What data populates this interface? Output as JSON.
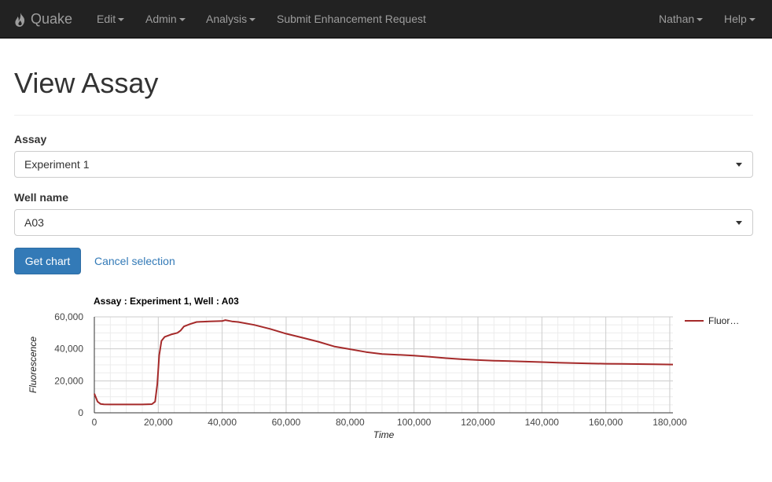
{
  "navbar": {
    "brand": "Quake",
    "menu": [
      {
        "label": "Edit",
        "dropdown": true
      },
      {
        "label": "Admin",
        "dropdown": true
      },
      {
        "label": "Analysis",
        "dropdown": true
      },
      {
        "label": "Submit Enhancement Request",
        "dropdown": false
      }
    ],
    "right_menu": [
      {
        "label": "Nathan",
        "dropdown": true
      },
      {
        "label": "Help",
        "dropdown": true
      }
    ]
  },
  "page": {
    "title": "View Assay"
  },
  "form": {
    "assay_label": "Assay",
    "assay_value": "Experiment 1",
    "well_label": "Well name",
    "well_value": "A03",
    "submit_label": "Get chart",
    "cancel_label": "Cancel selection"
  },
  "colors": {
    "navbar_bg": "#222222",
    "primary": "#337ab7",
    "series": "#a52a2a"
  },
  "chart_data": {
    "type": "line",
    "title": "Assay : Experiment 1, Well : A03",
    "xlabel": "Time",
    "ylabel": "Fluorescence",
    "xlim": [
      0,
      181000
    ],
    "ylim": [
      0,
      60000
    ],
    "x_ticks": [
      "0",
      "20,000",
      "40,000",
      "60,000",
      "80,000",
      "100,000",
      "120,000",
      "140,000",
      "160,000",
      "180,000"
    ],
    "y_ticks": [
      "0",
      "20,000",
      "40,000",
      "60,000"
    ],
    "grid": true,
    "legend": "right",
    "series": [
      {
        "name": "Fluor…",
        "x": [
          0,
          1000,
          2000,
          3000,
          5000,
          10000,
          15000,
          18000,
          19000,
          19700,
          20300,
          21000,
          22000,
          24000,
          26000,
          27000,
          28000,
          30000,
          32000,
          34000,
          36000,
          38000,
          40000,
          41000,
          43000,
          45000,
          50000,
          55000,
          60000,
          65000,
          70000,
          75000,
          80000,
          85000,
          90000,
          95000,
          100000,
          105000,
          110000,
          115000,
          120000,
          125000,
          130000,
          135000,
          140000,
          145000,
          150000,
          155000,
          160000,
          165000,
          170000,
          175000,
          181000
        ],
        "y": [
          12000,
          7000,
          5500,
          5300,
          5200,
          5200,
          5200,
          5400,
          7000,
          18000,
          36000,
          45000,
          47500,
          49000,
          50000,
          51500,
          54000,
          55500,
          56800,
          57000,
          57200,
          57300,
          57400,
          58000,
          57200,
          56800,
          55000,
          52500,
          49500,
          47000,
          44500,
          41500,
          39800,
          38000,
          36800,
          36300,
          35800,
          35000,
          34200,
          33500,
          33000,
          32600,
          32300,
          32000,
          31700,
          31400,
          31100,
          30900,
          30700,
          30600,
          30500,
          30400,
          30200
        ]
      }
    ]
  }
}
